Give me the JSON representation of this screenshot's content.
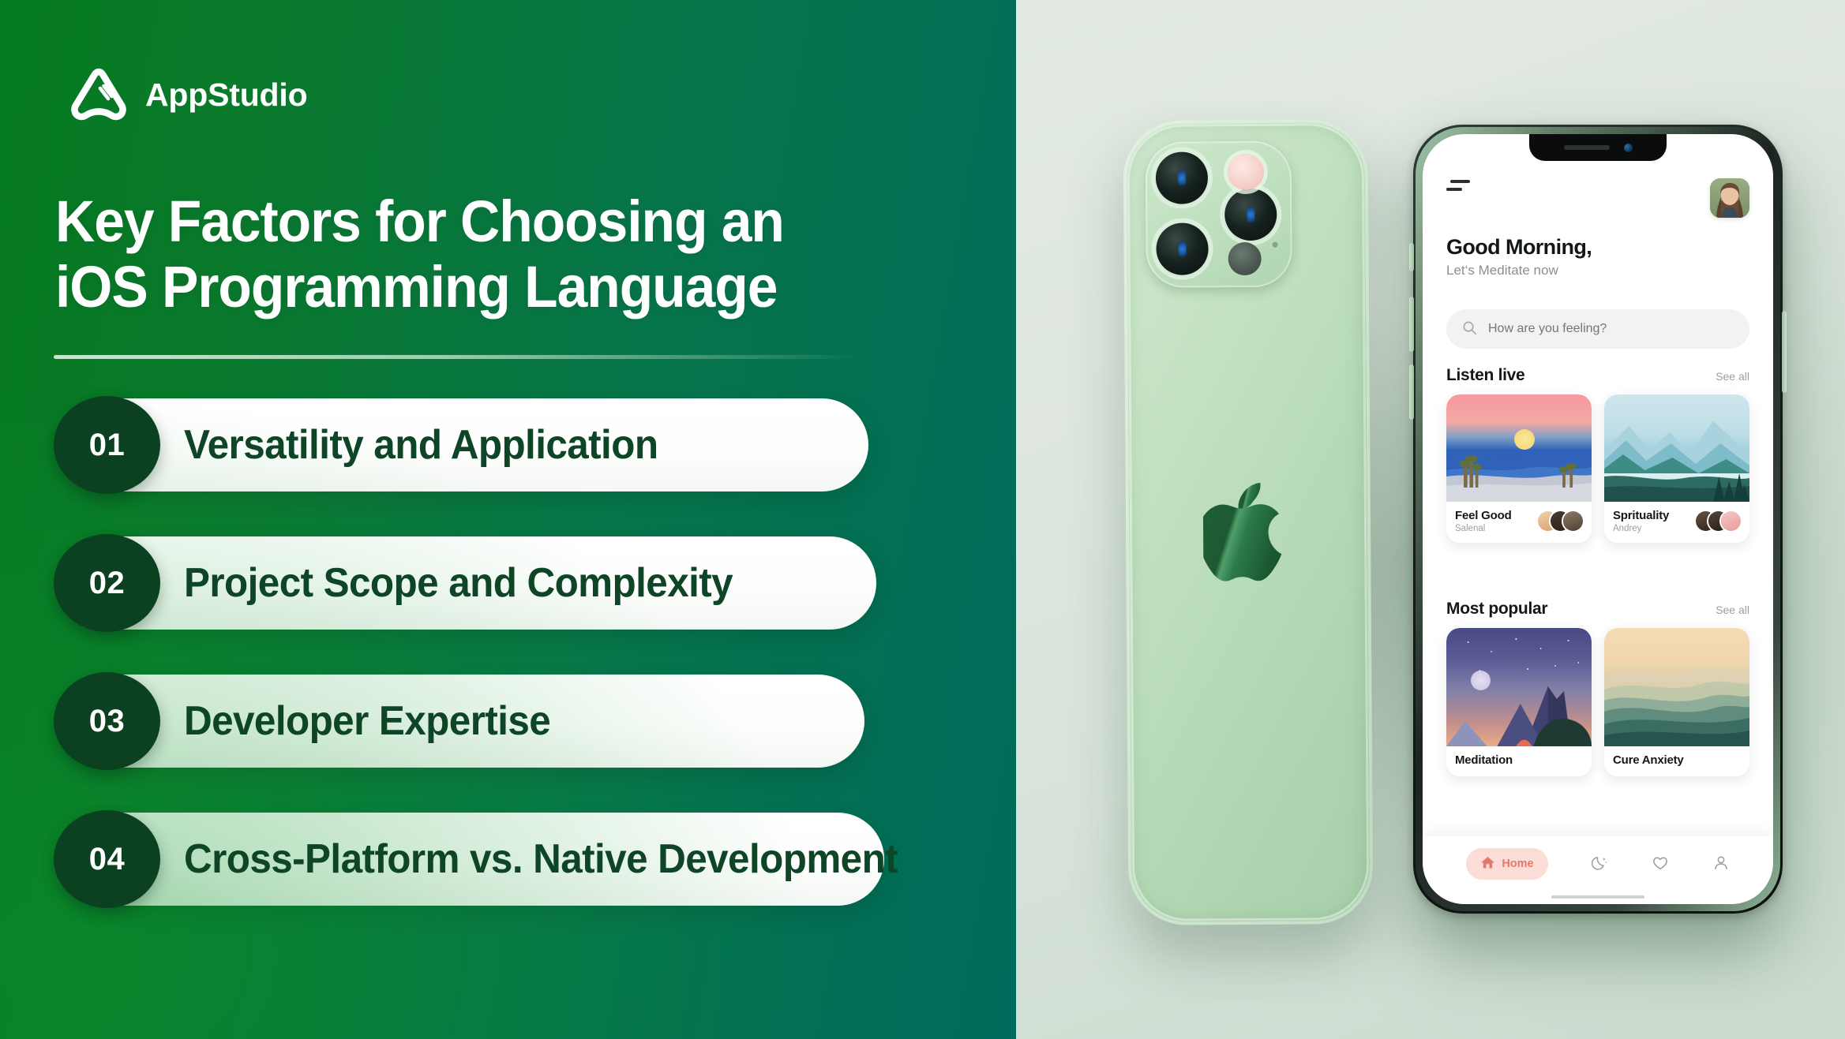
{
  "brand": {
    "name": "AppStudio",
    "logo_icon": "triangle-arrow-logo-icon",
    "green": "#067a20",
    "teal": "#006a5c",
    "dark_green": "#0b4021",
    "label_green": "#0d4526"
  },
  "headline": "Key Factors for Choosing an iOS Programming Language",
  "factors": [
    {
      "number": "01",
      "label": "Versatility and Application"
    },
    {
      "number": "02",
      "label": "Project Scope and Complexity"
    },
    {
      "number": "03",
      "label": "Developer Expertise"
    },
    {
      "number": "04",
      "label": "Cross-Platform vs. Native Development"
    }
  ],
  "phone_app": {
    "menu_icon": "hamburger-menu-icon",
    "avatar_icon": "user-avatar-photo",
    "greeting": "Good Morning,",
    "subgreeting": "Let‘s Meditate now",
    "search": {
      "icon": "search-icon",
      "placeholder": "How are you feeling?",
      "value": ""
    },
    "sections": [
      {
        "title": "Listen live",
        "see_all": "See all",
        "cards": [
          {
            "title": "Feel Good",
            "subtitle": "Salenal",
            "art": "desert-sunset-scene",
            "avatars": 3
          },
          {
            "title": "Sprituality",
            "subtitle": "Andrey",
            "art": "mountain-lake-scene",
            "avatars": 3
          }
        ]
      },
      {
        "title": "Most popular",
        "see_all": "See all",
        "cards": [
          {
            "title": "Meditation",
            "subtitle": "",
            "art": "night-mountain-scene",
            "avatars": 0
          },
          {
            "title": "Cure Anxiety",
            "subtitle": "",
            "art": "hazy-dunes-scene",
            "avatars": 0
          }
        ]
      }
    ],
    "tabs": [
      {
        "label": "Home",
        "icon": "home-icon",
        "active": true
      },
      {
        "label": "",
        "icon": "moon-sparkle-icon",
        "active": false
      },
      {
        "label": "",
        "icon": "heart-icon",
        "active": false
      },
      {
        "label": "",
        "icon": "person-icon",
        "active": false
      }
    ],
    "accent_color": "#e2796c"
  },
  "device": {
    "back_phone": {
      "camera_icon": "triple-camera-module-icon",
      "logo_icon": "apple-logo-icon"
    },
    "front_phone": {
      "notch_icon": "notch-speaker-camera"
    }
  }
}
